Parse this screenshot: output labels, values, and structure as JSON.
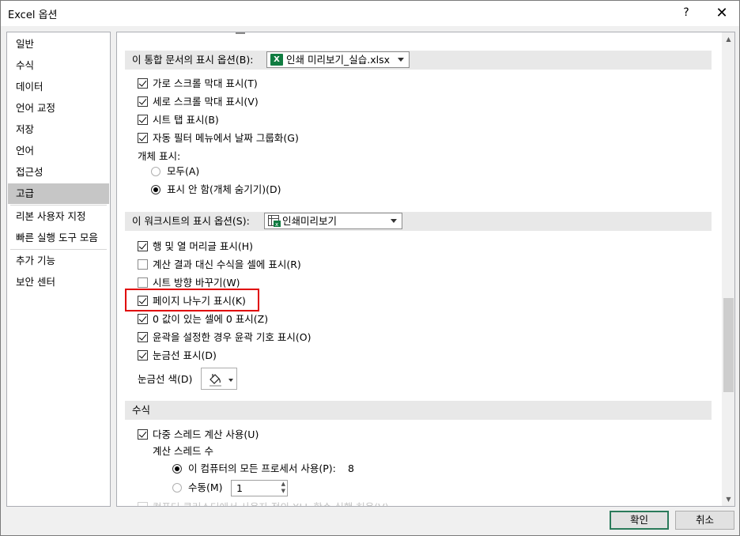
{
  "window": {
    "title": "Excel 옵션",
    "help_glyph": "?",
    "close_glyph": "✕"
  },
  "nav": {
    "items": [
      {
        "label": "일반"
      },
      {
        "label": "수식"
      },
      {
        "label": "데이터"
      },
      {
        "label": "언어 교정"
      },
      {
        "label": "저장"
      },
      {
        "label": "언어"
      },
      {
        "label": "접근성"
      },
      {
        "label": "고급",
        "selected": true
      },
      {
        "label": "리본 사용자 지정"
      },
      {
        "label": "빠른 실행 도구 모음"
      },
      {
        "label": "추가 기능"
      },
      {
        "label": "보안 센터"
      }
    ]
  },
  "workbook_section": {
    "header": "이 통합 문서의 표시 옵션(B):",
    "combo_value": "인쇄 미리보기_실습.xlsx",
    "options": [
      {
        "label": "가로 스크롤 막대 표시(T)",
        "checked": true
      },
      {
        "label": "세로 스크롤 막대 표시(V)",
        "checked": true
      },
      {
        "label": "시트 탭 표시(B)",
        "checked": true
      },
      {
        "label": "자동 필터 메뉴에서 날짜 그룹화(G)",
        "checked": true
      }
    ],
    "objects_label": "개체 표시:",
    "object_radios": [
      {
        "label": "모두(A)",
        "selected": false
      },
      {
        "label": "표시 안 함(개체 숨기기)(D)",
        "selected": true
      }
    ]
  },
  "worksheet_section": {
    "header": "이 워크시트의 표시 옵션(S):",
    "combo_value": "인쇄미리보기",
    "options": [
      {
        "label": "행 및 열 머리글 표시(H)",
        "checked": true
      },
      {
        "label": "계산 결과 대신 수식을 셀에 표시(R)",
        "checked": false
      },
      {
        "label": "시트 방향 바꾸기(W)",
        "checked": false
      },
      {
        "label": "페이지 나누기 표시(K)",
        "checked": true
      },
      {
        "label": "0 값이 있는 셀에 0 표시(Z)",
        "checked": true
      },
      {
        "label": "윤곽을 설정한 경우 윤곽 기호 표시(O)",
        "checked": true
      },
      {
        "label": "눈금선 표시(D)",
        "checked": true
      }
    ],
    "gridline_color_label": "눈금선 색(D)"
  },
  "formula_section": {
    "header": "수식",
    "multithread_label": "다중 스레드 계산 사용(U)",
    "multithread_checked": true,
    "thread_count_label": "계산 스레드 수",
    "all_processors_label": "이 컴퓨터의 모든 프로세서 사용(P):",
    "all_processors_value": "8",
    "manual_label": "수동(M)",
    "manual_value": "1",
    "cut_off_text": "컴퓨터 클러스터에서 사용자 정의 XLL 함수 실행 허용(V)"
  },
  "buttons": {
    "ok": "확인",
    "cancel": "취소"
  },
  "colors": {
    "highlight": "#e00000",
    "excel_green": "#107c41",
    "selected_nav": "#c6c6c6"
  }
}
